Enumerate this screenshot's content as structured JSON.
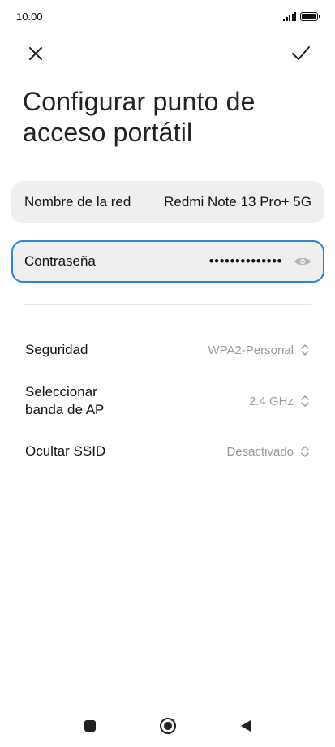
{
  "status_bar": {
    "time": "10:00"
  },
  "toolbar": {
    "close_icon": "close-icon",
    "confirm_icon": "check-icon"
  },
  "title": "Configurar punto de acceso portátil",
  "ssid_field": {
    "label": "Nombre de la red",
    "value": "Redmi Note 13 Pro+ 5G"
  },
  "password_field": {
    "label": "Contraseña",
    "value": "••••••••••••••",
    "icon": "eye-icon"
  },
  "settings": [
    {
      "label": "Seguridad",
      "value": "WPA2-Personal"
    },
    {
      "label": "Seleccionar banda de AP",
      "value": "2.4 GHz"
    },
    {
      "label": "Ocultar SSID",
      "value": "Desactivado"
    }
  ],
  "colors": {
    "accent": "#2c84d8",
    "field_bg": "#efefef",
    "secondary_text": "#9a9a9a"
  },
  "nav": {
    "recents": "square-icon",
    "home": "circle-icon",
    "back": "triangle-back-icon"
  }
}
